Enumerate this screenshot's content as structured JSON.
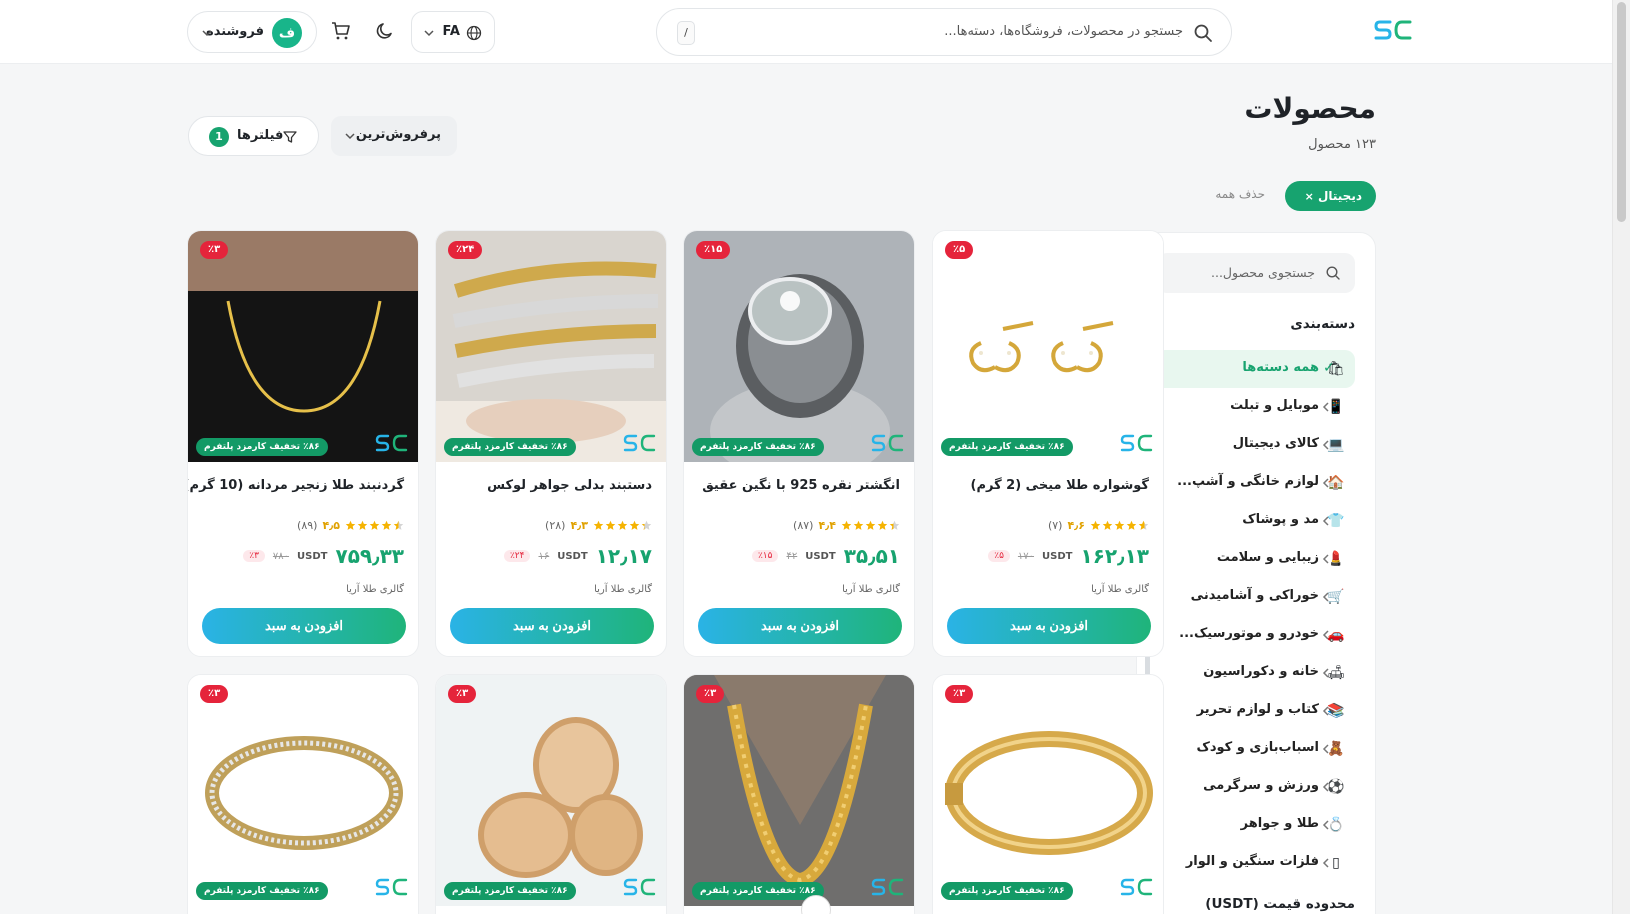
{
  "header": {
    "search_placeholder": "جستجو در محصولات، فروشگاه‌ها، دسته‌ها...",
    "search_shortcut": "/",
    "language": "FA",
    "seller_label": "فروشنده",
    "seller_avatar": "ف"
  },
  "page": {
    "title": "محصولات",
    "count": "۱۲۳ محصول",
    "active_filter": "دیجیتال",
    "clear_all": "حذف همه",
    "sort_label": "پرفروش‌ترین",
    "filters_label": "فیلترها",
    "filters_count": "1"
  },
  "sidebar": {
    "search_placeholder": "جستجوی محصول...",
    "category_heading": "دسته‌بندی",
    "price_heading": "محدوده قیمت (USDT)",
    "categories": [
      {
        "label": "همه دسته‌ها",
        "emoji": "🛍",
        "active": true
      },
      {
        "label": "موبایل و تبلت",
        "emoji": "📱"
      },
      {
        "label": "کالای دیجیتال",
        "emoji": "💻"
      },
      {
        "label": "لوازم خانگی و آشپ...",
        "emoji": "🏠"
      },
      {
        "label": "مد و پوشاک",
        "emoji": "👕"
      },
      {
        "label": "زیبایی و سلامت",
        "emoji": "💄"
      },
      {
        "label": "خوراکی و آشامیدنی",
        "emoji": "🛒"
      },
      {
        "label": "خودرو و موتورسیک...",
        "emoji": "🚗"
      },
      {
        "label": "خانه و دکوراسیون",
        "emoji": "🛋"
      },
      {
        "label": "کتاب و لوازم تحریر",
        "emoji": "📚"
      },
      {
        "label": "اسباب‌بازی و کودک",
        "emoji": "🧸"
      },
      {
        "label": "ورزش و سرگرمی",
        "emoji": "⚽"
      },
      {
        "label": "طلا و جواهر",
        "emoji": "💍"
      },
      {
        "label": "فلزات سنگین و الوار",
        "emoji": "▯"
      }
    ]
  },
  "products": [
    {
      "title": "گوشواره طلا میخی (2 گرم)",
      "discount": "٪۵",
      "promo": "٪۸۶ تخفیف کارمزد پلتفرم",
      "rating": "۴٫۶",
      "rating_value": 4.6,
      "reviews": "(۷)",
      "price": "۱۶۲٫۱۳",
      "currency": "USDT",
      "old_price": "۱۷۰",
      "pct": "٪۵",
      "shop": "گالری طلا آریا",
      "cta": "افزودن به سبد",
      "image": "earrings"
    },
    {
      "title": "انگشتر نقره 925 با نگین عقیق",
      "discount": "٪۱۵",
      "promo": "٪۸۶ تخفیف کارمزد پلتفرم",
      "rating": "۴٫۴",
      "rating_value": 4.4,
      "reviews": "(۸۷)",
      "price": "۳۵٫۵۱",
      "currency": "USDT",
      "old_price": "۴۲",
      "pct": "٪۱۵",
      "shop": "گالری طلا آریا",
      "cta": "افزودن به سبد",
      "image": "ring"
    },
    {
      "title": "دستبند بدلی جواهر لوکس",
      "discount": "٪۲۴",
      "promo": "٪۸۶ تخفیف کارمزد پلتفرم",
      "rating": "۴٫۳",
      "rating_value": 4.3,
      "reviews": "(۲۸)",
      "price": "۱۲٫۱۷",
      "currency": "USDT",
      "old_price": "۱۶",
      "pct": "٪۲۴",
      "shop": "گالری طلا آریا",
      "cta": "افزودن به سبد",
      "image": "bracelets"
    },
    {
      "title": "گردنبند طلا زنجیر مردانه (10 گرم)",
      "discount": "٪۳",
      "promo": "٪۸۶ تخفیف کارمزد پلتفرم",
      "rating": "۴٫۵",
      "rating_value": 4.5,
      "reviews": "(۸۹)",
      "price": "۷۵۹٫۳۳",
      "currency": "USDT",
      "old_price": "۷۸۰",
      "pct": "٪۳",
      "shop": "گالری طلا آریا",
      "cta": "افزودن به سبد",
      "image": "necklace"
    },
    {
      "title": "",
      "discount": "٪۳",
      "promo": "٪۸۶ تخفیف کارمزد پلتفرم",
      "image": "bangle"
    },
    {
      "title": "",
      "discount": "٪۳",
      "promo": "٪۸۶ تخفیف کارمزد پلتفرم",
      "image": "chain"
    },
    {
      "title": "",
      "discount": "٪۳",
      "promo": "٪۸۶ تخفیف کارمزد پلتفرم",
      "image": "rings"
    },
    {
      "title": "",
      "discount": "٪۳",
      "promo": "٪۸۶ تخفیف کارمزد پلتفرم",
      "image": "bracelet"
    }
  ],
  "watermark": "shopceeper",
  "colors": {
    "accent": "#17a36f",
    "discount": "#e5243b",
    "star": "#f5b301"
  }
}
